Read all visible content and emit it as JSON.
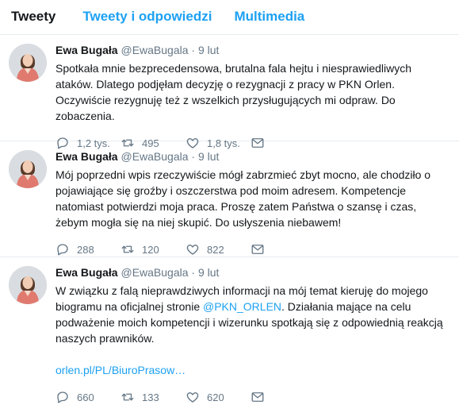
{
  "tabs": [
    {
      "label": "Tweety",
      "active": true
    },
    {
      "label": "Tweety i odpowiedzi",
      "active": false
    },
    {
      "label": "Multimedia",
      "active": false
    }
  ],
  "tweets": [
    {
      "name": "Ewa Bugała",
      "handle": "@EwaBugala",
      "separator": "·",
      "time": "9 lut",
      "text": "Spotkała mnie bezprecedensowa, brutalna fala hejtu i niesprawiedliwych ataków. Dlatego podjęłam decyzję o rezygnacji z pracy w PKN Orlen. Oczywiście rezygnuję też z wszelkich przysługujących mi odpraw. Do zobaczenia.",
      "replies": "1,2 tys.",
      "retweets": "495",
      "likes": "1,8 tys."
    },
    {
      "name": "Ewa Bugała",
      "handle": "@EwaBugala",
      "separator": "·",
      "time": "9 lut",
      "text": "Mój poprzedni wpis rzeczywiście mógł zabrzmieć zbyt mocno, ale chodziło o pojawiające się groźby i oszczerstwa pod moim adresem. Kompetencje natomiast potwierdzi moja praca. Proszę zatem Państwa o szansę i czas, żebym mogła się na niej skupić. Do usłyszenia niebawem!",
      "replies": "288",
      "retweets": "120",
      "likes": "822"
    },
    {
      "name": "Ewa Bugała",
      "handle": "@EwaBugala",
      "separator": "·",
      "time": "9 lut",
      "text_before": "W związku z falą nieprawdziwych informacji na mój temat kieruję do mojego biogramu na oficjalnej stronie ",
      "mention": "@PKN_ORLEN",
      "text_after": ". Działania mające na celu podważenie moich kompetencji i wizerunku spotkają się z odpowiednią reakcją naszych prawników.",
      "link": "orlen.pl/PL/BiuroPrasow…",
      "replies": "660",
      "retweets": "133",
      "likes": "620"
    }
  ],
  "colors": {
    "accent": "#1da1f2",
    "muted": "#657786",
    "text": "#14171a",
    "border": "#e6ecf0"
  },
  "icons": [
    "reply-icon",
    "retweet-icon",
    "like-icon",
    "direct-message-icon",
    "avatar"
  ]
}
